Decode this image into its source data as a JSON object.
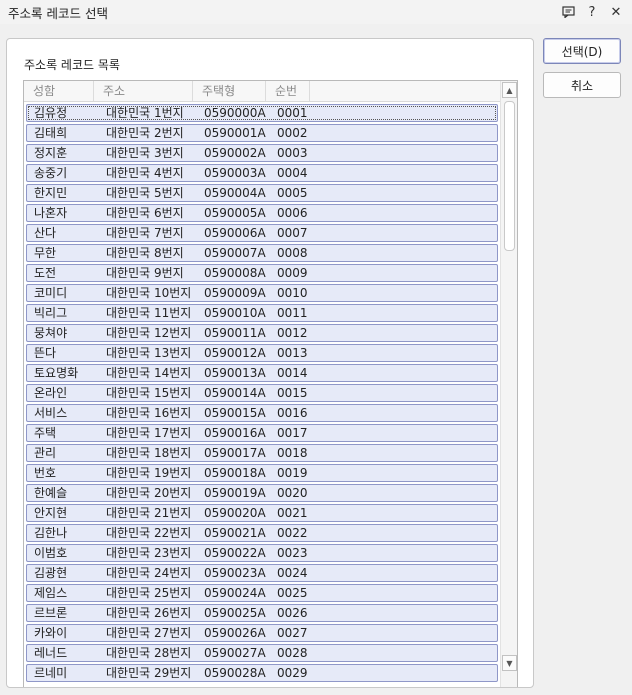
{
  "window": {
    "title": "주소록 레코드 선택",
    "buttons": {
      "comment": "comment-icon",
      "help": "?",
      "close": "✕"
    }
  },
  "panel": {
    "title": "주소록 레코드 목록"
  },
  "list": {
    "columns": [
      "성함",
      "주소",
      "주택형",
      "순번"
    ],
    "rows": [
      {
        "name": "김유정",
        "addr": "대한민국 1번지",
        "code": "0590000A",
        "seq": "0001"
      },
      {
        "name": "김태희",
        "addr": "대한민국 2번지",
        "code": "0590001A",
        "seq": "0002"
      },
      {
        "name": "정지훈",
        "addr": "대한민국 3번지",
        "code": "0590002A",
        "seq": "0003"
      },
      {
        "name": "송중기",
        "addr": "대한민국 4번지",
        "code": "0590003A",
        "seq": "0004"
      },
      {
        "name": "한지민",
        "addr": "대한민국 5번지",
        "code": "0590004A",
        "seq": "0005"
      },
      {
        "name": "나혼자",
        "addr": "대한민국 6번지",
        "code": "0590005A",
        "seq": "0006"
      },
      {
        "name": "산다",
        "addr": "대한민국 7번지",
        "code": "0590006A",
        "seq": "0007"
      },
      {
        "name": "무한",
        "addr": "대한민국 8번지",
        "code": "0590007A",
        "seq": "0008"
      },
      {
        "name": "도전",
        "addr": "대한민국 9번지",
        "code": "0590008A",
        "seq": "0009"
      },
      {
        "name": "코미디",
        "addr": "대한민국 10번지",
        "code": "0590009A",
        "seq": "0010"
      },
      {
        "name": "빅리그",
        "addr": "대한민국 11번지",
        "code": "0590010A",
        "seq": "0011"
      },
      {
        "name": "뭉쳐야",
        "addr": "대한민국 12번지",
        "code": "0590011A",
        "seq": "0012"
      },
      {
        "name": "뜬다",
        "addr": "대한민국 13번지",
        "code": "0590012A",
        "seq": "0013"
      },
      {
        "name": "토요명화",
        "addr": "대한민국 14번지",
        "code": "0590013A",
        "seq": "0014"
      },
      {
        "name": "온라인",
        "addr": "대한민국 15번지",
        "code": "0590014A",
        "seq": "0015"
      },
      {
        "name": "서비스",
        "addr": "대한민국 16번지",
        "code": "0590015A",
        "seq": "0016"
      },
      {
        "name": "주택",
        "addr": "대한민국 17번지",
        "code": "0590016A",
        "seq": "0017"
      },
      {
        "name": "관리",
        "addr": "대한민국 18번지",
        "code": "0590017A",
        "seq": "0018"
      },
      {
        "name": "번호",
        "addr": "대한민국 19번지",
        "code": "0590018A",
        "seq": "0019"
      },
      {
        "name": "한예슬",
        "addr": "대한민국 20번지",
        "code": "0590019A",
        "seq": "0020"
      },
      {
        "name": "안지현",
        "addr": "대한민국 21번지",
        "code": "0590020A",
        "seq": "0021"
      },
      {
        "name": "김한나",
        "addr": "대한민국 22번지",
        "code": "0590021A",
        "seq": "0022"
      },
      {
        "name": "이범호",
        "addr": "대한민국 23번지",
        "code": "0590022A",
        "seq": "0023"
      },
      {
        "name": "김광현",
        "addr": "대한민국 24번지",
        "code": "0590023A",
        "seq": "0024"
      },
      {
        "name": "제임스",
        "addr": "대한민국 25번지",
        "code": "0590024A",
        "seq": "0025"
      },
      {
        "name": "르브론",
        "addr": "대한민국 26번지",
        "code": "0590025A",
        "seq": "0026"
      },
      {
        "name": "카와이",
        "addr": "대한민국 27번지",
        "code": "0590026A",
        "seq": "0027"
      },
      {
        "name": "레너드",
        "addr": "대한민국 28번지",
        "code": "0590027A",
        "seq": "0028"
      },
      {
        "name": "르네미",
        "addr": "대한민국 29번지",
        "code": "0590028A",
        "seq": "0029"
      }
    ]
  },
  "buttons": {
    "select": "선택(D)",
    "cancel": "취소"
  },
  "colors": {
    "row_bg": "#e6eaf8",
    "row_border": "#8f97c8"
  }
}
